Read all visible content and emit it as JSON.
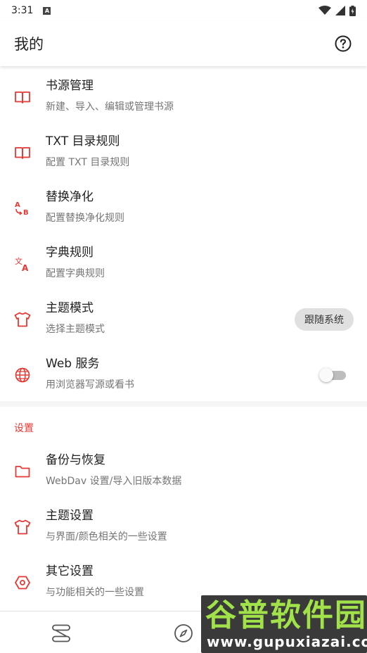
{
  "status_bar": {
    "time": "3:31",
    "notification": "A"
  },
  "app_bar": {
    "title": "我的"
  },
  "section_main": {
    "items": [
      {
        "title": "书源管理",
        "subtitle": "新建、导入、编辑或管理书源",
        "icon": "book-icon"
      },
      {
        "title": "TXT 目录规则",
        "subtitle": "配置 TXT 目录规则",
        "icon": "book-icon"
      },
      {
        "title": "替换净化",
        "subtitle": "配置替换净化规则",
        "icon": "replace-ab-icon"
      },
      {
        "title": "字典规则",
        "subtitle": "配置字典规则",
        "icon": "translate-icon"
      },
      {
        "title": "主题模式",
        "subtitle": "选择主题模式",
        "icon": "shirt-icon",
        "chip": "跟随系统"
      },
      {
        "title": "Web 服务",
        "subtitle": "用浏览器写源或看书",
        "icon": "globe-icon",
        "switch_on": false
      }
    ]
  },
  "section_settings": {
    "header": "设置",
    "items": [
      {
        "title": "备份与恢复",
        "subtitle": "WebDav 设置/导入旧版本数据",
        "icon": "folder-icon"
      },
      {
        "title": "主题设置",
        "subtitle": "与界面/颜色相关的一些设置",
        "icon": "shirt-icon"
      },
      {
        "title": "其它设置",
        "subtitle": "与功能相关的一些设置",
        "icon": "hexagon-gear-icon"
      }
    ]
  },
  "bottom_nav": {
    "items": [
      "bookshelf-icon",
      "compass-icon"
    ]
  },
  "watermark": {
    "line1": "谷普软件园",
    "line2": "www.gupuxiazai.com"
  },
  "colors": {
    "accent": "#e53935",
    "text_primary": "#212121",
    "text_secondary": "#757575"
  }
}
